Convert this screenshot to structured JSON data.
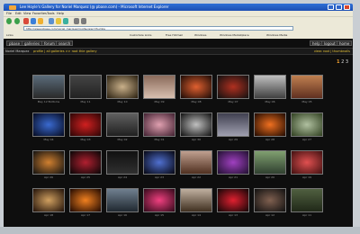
{
  "window": {
    "title": "Lee Hoyle's Gallery for Noriel Marquez (@ pbase.com) - Microsoft Internet Explorer",
    "address": "http://www.pbase.com/noriel_marquez/root&view=thumbs"
  },
  "menu": [
    "File",
    "Edit",
    "View",
    "Favorites",
    "Tools",
    "Help"
  ],
  "links": [
    "Links",
    "Customize Links",
    "Free Hotmail",
    "Windows",
    "Windows Marketplace",
    "Windows Media"
  ],
  "nav": {
    "tabs": [
      "pbase",
      "galleries",
      "forum",
      "search"
    ],
    "right_tabs": [
      "help",
      "logout",
      "home"
    ]
  },
  "crumb": {
    "user": "Noriel Marquez",
    "path": "profile | all galleries >> root thie gallery",
    "right": "view: root | thumbnails"
  },
  "pager": {
    "current": "1",
    "rest": "2 3"
  },
  "thumbs": [
    {
      "caption": "May 12 Bottoms"
    },
    {
      "caption": "May 11"
    },
    {
      "caption": "May 10"
    },
    {
      "caption": "May 09"
    },
    {
      "caption": "May 08"
    },
    {
      "caption": "May 07"
    },
    {
      "caption": "May 06"
    },
    {
      "caption": "May 05"
    },
    {
      "caption": "May 04"
    },
    {
      "caption": "May 03"
    },
    {
      "caption": "May 02"
    },
    {
      "caption": "May 01"
    },
    {
      "caption": "Apr 30"
    },
    {
      "caption": "Apr 29"
    },
    {
      "caption": "Apr 28"
    },
    {
      "caption": "Apr 27"
    },
    {
      "caption": "Apr 26"
    },
    {
      "caption": "Apr 25"
    },
    {
      "caption": "Apr 24"
    },
    {
      "caption": "Apr 23"
    },
    {
      "caption": "Apr 22"
    },
    {
      "caption": "Apr 21"
    },
    {
      "caption": "Apr 20"
    },
    {
      "caption": "Apr 19"
    },
    {
      "caption": "Apr 18"
    },
    {
      "caption": "Apr 17"
    },
    {
      "caption": "Apr 16"
    },
    {
      "caption": "Apr 15"
    },
    {
      "caption": "Apr 14"
    },
    {
      "caption": "Apr 13"
    },
    {
      "caption": "Apr 12"
    },
    {
      "caption": "Apr 11"
    }
  ],
  "colors": {
    "page_bg": "#0e0e0e",
    "accent": "#e8c437",
    "titlebar": "#2f6fd6"
  }
}
